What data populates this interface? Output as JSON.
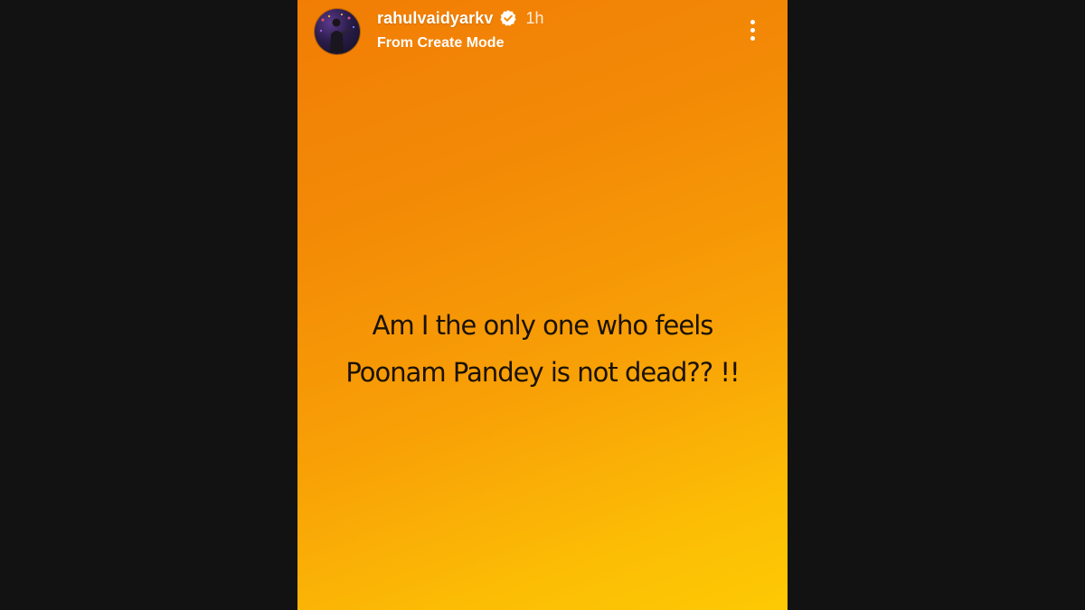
{
  "story": {
    "username": "rahulvaidyarkv",
    "time_ago": "1h",
    "subtitle": "From Create Mode",
    "caption_line_1": "Am I the only one who feels",
    "caption_line_2": "Poonam Pandey is not dead?? !!"
  },
  "icons": {
    "verified": "verified-badge-icon",
    "more": "vertical-ellipsis-icon"
  },
  "colors": {
    "backdrop": "#121212",
    "gradient_top": "#f17d05",
    "gradient_bottom": "#fdc904",
    "caption_text": "#1a1207"
  }
}
